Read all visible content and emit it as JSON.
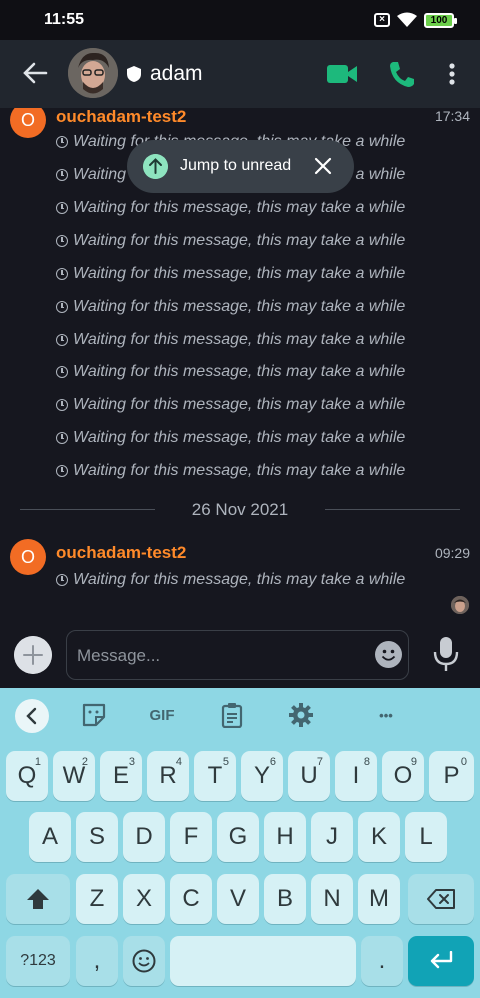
{
  "status_bar": {
    "time": "11:55",
    "battery": "100"
  },
  "header": {
    "title": "adam"
  },
  "first_message": {
    "avatar_letter": "O",
    "sender": "ouchadam-test2",
    "time": "17:34"
  },
  "waiting_text": "Waiting for this message, this may take a while",
  "date_divider": "26 Nov 2021",
  "second_message": {
    "avatar_letter": "O",
    "sender": "ouchadam-test2",
    "time": "09:29",
    "text": "Waiting for this message, this may take a while"
  },
  "jump_pill": {
    "label": "Jump to unread"
  },
  "composer": {
    "placeholder": "Message..."
  },
  "keyboard": {
    "tools": {
      "gif": "GIF",
      "more": "•••"
    },
    "row1": [
      {
        "k": "Q",
        "n": "1"
      },
      {
        "k": "W",
        "n": "2"
      },
      {
        "k": "E",
        "n": "3"
      },
      {
        "k": "R",
        "n": "4"
      },
      {
        "k": "T",
        "n": "5"
      },
      {
        "k": "Y",
        "n": "6"
      },
      {
        "k": "U",
        "n": "7"
      },
      {
        "k": "I",
        "n": "8"
      },
      {
        "k": "O",
        "n": "9"
      },
      {
        "k": "P",
        "n": "0"
      }
    ],
    "row2": [
      "A",
      "S",
      "D",
      "F",
      "G",
      "H",
      "J",
      "K",
      "L"
    ],
    "row3": [
      "Z",
      "X",
      "C",
      "V",
      "B",
      "N",
      "M"
    ],
    "symbols": "?123",
    "comma": ",",
    "period": "."
  },
  "colors": {
    "accent_green": "#1db97c",
    "sender_orange": "#ff8a2a",
    "avatar_orange": "#f26c24",
    "keyboard_bg": "#8ed7e4"
  }
}
